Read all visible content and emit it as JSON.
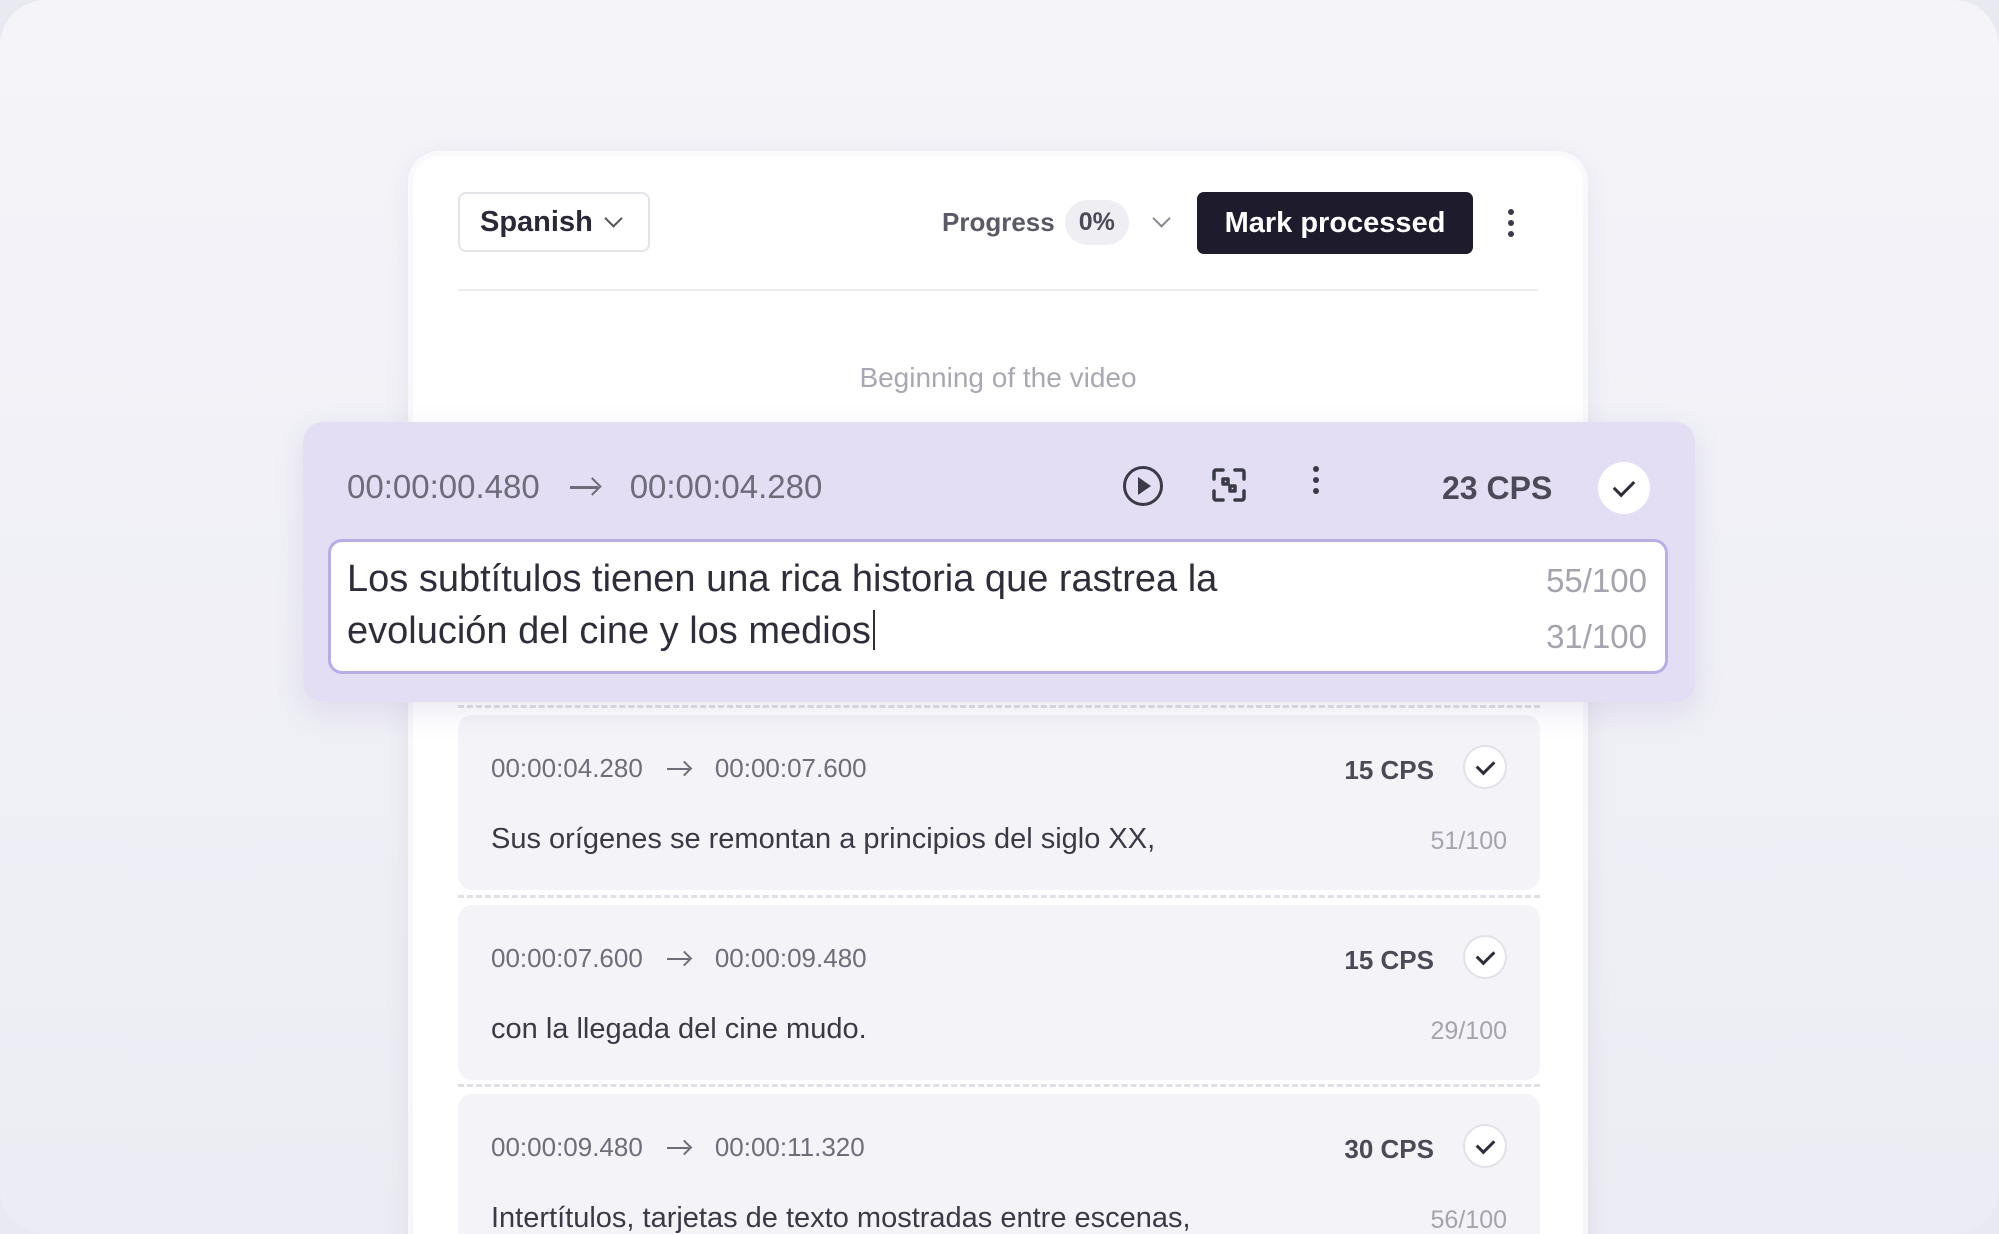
{
  "toolbar": {
    "language": "Spanish",
    "progress_label": "Progress",
    "progress_value": "0%",
    "mark_processed_label": "Mark processed"
  },
  "beginning_label": "Beginning of the video",
  "active": {
    "start": "00:00:00.480",
    "end": "00:00:04.280",
    "cps": "23 CPS",
    "line1": "Los subtítulos tienen una rica historia que rastrea la",
    "line2": "evolución del cine y los medios",
    "count1": "55/100",
    "count2": "31/100"
  },
  "segments": [
    {
      "start": "00:00:04.280",
      "end": "00:00:07.600",
      "cps": "15 CPS",
      "text": "Sus orígenes se remontan a principios del siglo XX,",
      "count": "51/100"
    },
    {
      "start": "00:00:07.600",
      "end": "00:00:09.480",
      "cps": "15 CPS",
      "text": "con la llegada del cine mudo.",
      "count": "29/100"
    },
    {
      "start": "00:00:09.480",
      "end": "00:00:11.320",
      "cps": "30 CPS",
      "text": "Intertítulos, tarjetas de texto mostradas entre escenas,",
      "count": "56/100"
    }
  ],
  "colors": {
    "accent": "#e3def4",
    "accent_border": "#b9ade6",
    "button_dark": "#1d1b2c"
  },
  "icons": [
    "chevron-down-icon",
    "more-vertical-icon",
    "arrow-right-icon",
    "play-icon",
    "merge-icon",
    "check-icon"
  ]
}
